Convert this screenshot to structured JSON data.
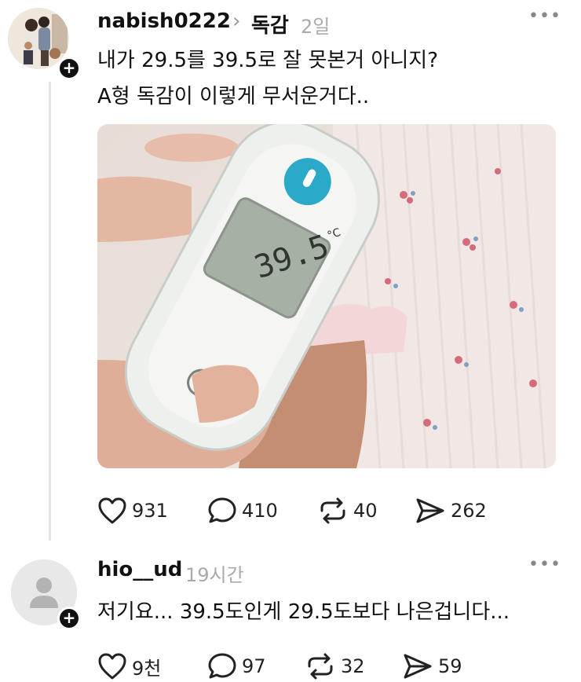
{
  "post": {
    "username": "nabish0222",
    "topic": "독감",
    "time": "2일",
    "text_line1": "내가 29.5를 39.5로 잘 못본거 아니지?",
    "text_line2": "A형 독감이 이렇게 무서운거다..",
    "photo": {
      "thermometer_display": "39.5",
      "thermometer_unit": "°C"
    },
    "stats": {
      "likes": "931",
      "comments": "410",
      "reposts": "40",
      "shares": "262"
    }
  },
  "reply": {
    "username": "hio__ud",
    "time": "19시간",
    "text": "저기요... 39.5도인게 29.5도보다 나은겁니다...",
    "stats": {
      "likes": "9천",
      "comments": "97",
      "reposts": "32",
      "shares": "59"
    }
  },
  "icons": {
    "like": "heart-icon",
    "comment": "comment-bubble-icon",
    "repost": "repost-icon",
    "share": "send-icon",
    "more": "more-dots-icon",
    "follow": "plus-icon"
  },
  "colors": {
    "text": "#111111",
    "muted": "#aaaaaa",
    "thread_line": "#e3e3e3",
    "thermometer_accent": "#2aa9c8"
  }
}
